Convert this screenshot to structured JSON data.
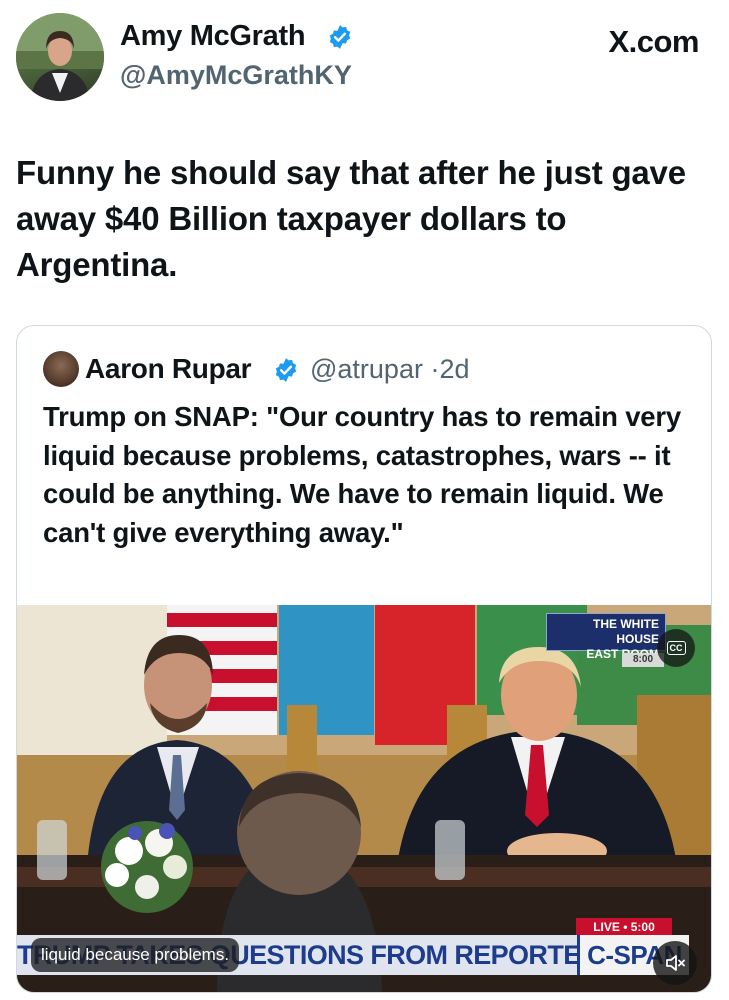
{
  "tweet": {
    "author_name": "Amy McGrath",
    "author_handle": "@AmyMcGrathKY",
    "site_label": "X.com",
    "text": "Funny he should say that after he just gave away $40 Billion taxpayer dollars to Argentina."
  },
  "quote": {
    "author_name": "Aaron Rupar",
    "author_handle": "@atrupar",
    "separator": "·",
    "age": "2d",
    "text": "Trump on SNAP: \"Our country has to remain very liquid because problems, catastrophes, wars -- it could be anything. We have to remain liquid. We can't give everything away.\""
  },
  "video": {
    "wh_badge_line1": "THE WHITE HOUSE",
    "wh_badge_line2": "EAST ROOM",
    "wh_time": "8:00",
    "cc_label": "CC",
    "live_label": "LIVE • 5:00",
    "lower_third": "TRUMP TAKES QUESTIONS FROM REPORTERS",
    "network": "C-SPAN",
    "caption": "liquid because problems.",
    "mute_icon": "speaker-muted-icon"
  },
  "colors": {
    "verified": "#1d9bf0",
    "text": "#0f1419",
    "muted": "#536471"
  }
}
